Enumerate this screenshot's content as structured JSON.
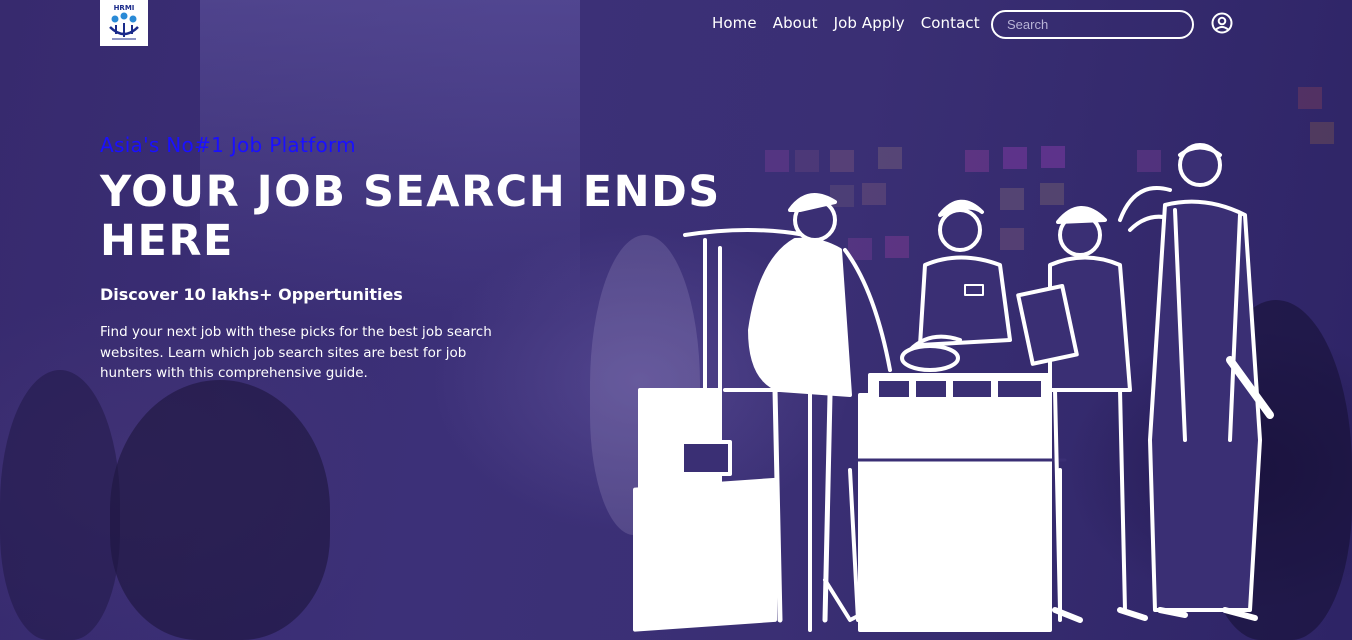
{
  "brand": {
    "logo_text": "HRMI"
  },
  "nav": {
    "items": [
      "Home",
      "About",
      "Job Apply",
      "Contact"
    ],
    "search_placeholder": "Search"
  },
  "hero": {
    "tagline": "Asia's No#1 Job Platform",
    "headline": "YOUR JOB SEARCH ENDS HERE",
    "subhead": "Discover 10 lakhs+ Oppertunities",
    "description": "Find your next job with these picks for the best job search websites. Learn which job search sites are best for job hunters with this comprehensive guide."
  },
  "icons": {
    "account": "user-circle-icon",
    "logo": "hrmi-logo-icon"
  },
  "colors": {
    "overlay": "#3a2f74",
    "tagline": "#1a10ff",
    "text": "#ffffff"
  }
}
